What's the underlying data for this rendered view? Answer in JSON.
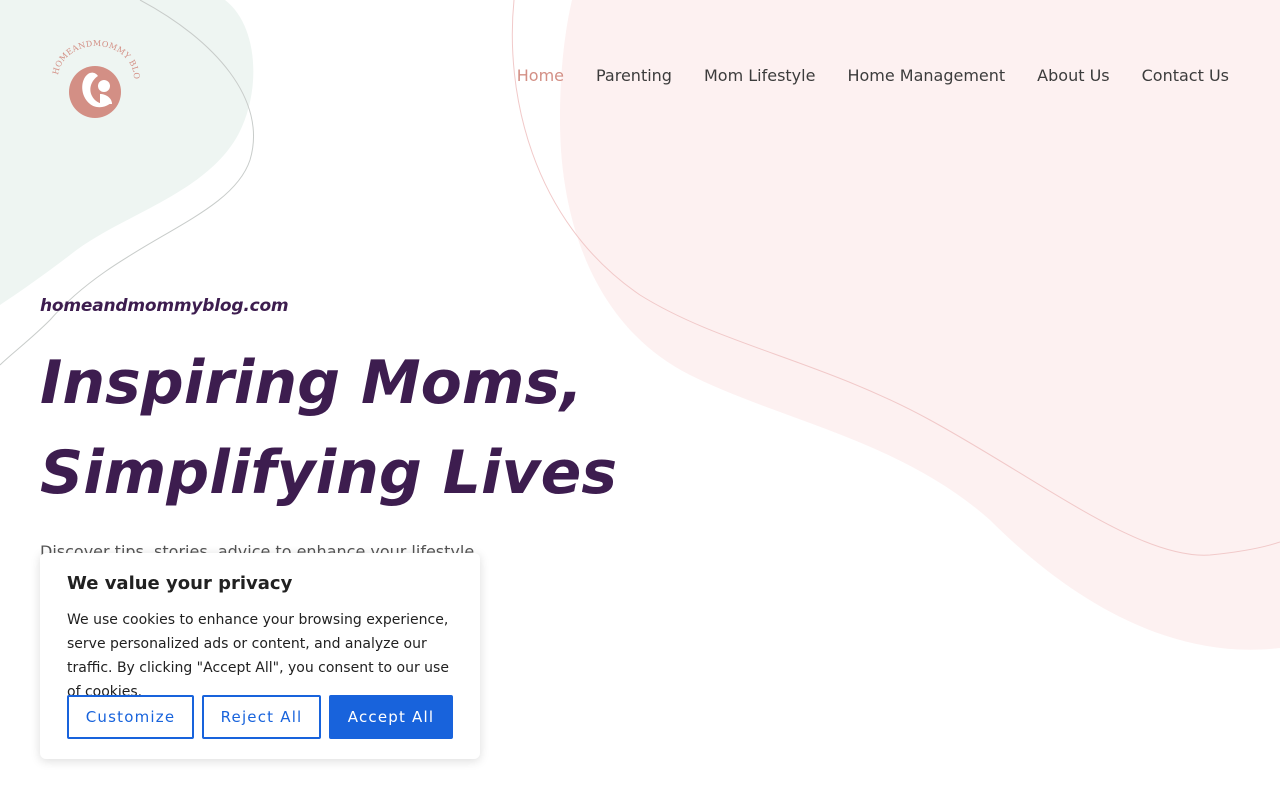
{
  "header": {
    "logo_text": "HOMEANDMOMMY BLOG",
    "nav": [
      {
        "label": "Home",
        "active": true
      },
      {
        "label": "Parenting",
        "active": false
      },
      {
        "label": "Mom Lifestyle",
        "active": false
      },
      {
        "label": "Home Management",
        "active": false
      },
      {
        "label": "About Us",
        "active": false
      },
      {
        "label": "Contact Us",
        "active": false
      }
    ]
  },
  "hero": {
    "site_name": "homeandmommyblog.com",
    "headline_line1": "Inspiring Moms,",
    "headline_line2": "Simplifying Lives",
    "intro": "Discover tips, stories, advice to enhance your lifestyle, parenting"
  },
  "cookie_banner": {
    "title": "We value your privacy",
    "body": "We use cookies to enhance your browsing experience, serve personalized ads or content, and analyze our traffic. By clicking \"Accept All\", you consent to our use of cookies.",
    "customize_label": "Customize",
    "reject_label": "Reject All",
    "accept_label": "Accept All"
  },
  "colors": {
    "accent_pink": "#d38f85",
    "headline_purple": "#3d1d4f",
    "cookie_blue": "#1863dc",
    "blob_green": "#eef5f2",
    "blob_pink": "#fdf1f1"
  }
}
